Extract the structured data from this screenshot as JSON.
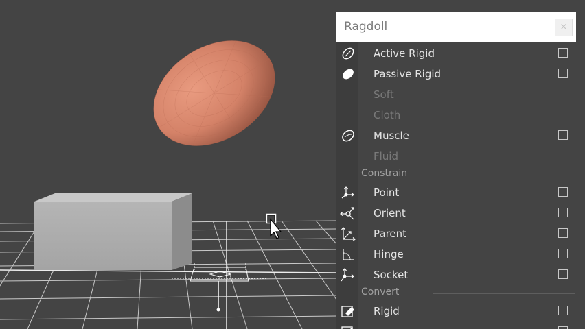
{
  "menu": {
    "title": "Ragdoll",
    "close_label": "×",
    "items": [
      {
        "label": "Active Rigid",
        "icon": "active-rigid-icon",
        "enabled": true,
        "has_option": true
      },
      {
        "label": "Passive Rigid",
        "icon": "passive-rigid-icon",
        "enabled": true,
        "has_option": true
      },
      {
        "label": "Soft",
        "icon": "",
        "enabled": false,
        "has_option": false
      },
      {
        "label": "Cloth",
        "icon": "",
        "enabled": false,
        "has_option": false
      },
      {
        "label": "Muscle",
        "icon": "muscle-icon",
        "enabled": true,
        "has_option": true
      },
      {
        "label": "Fluid",
        "icon": "",
        "enabled": false,
        "has_option": false
      }
    ],
    "constrain": {
      "label": "Constrain",
      "items": [
        {
          "label": "Point",
          "icon": "point-constraint-icon"
        },
        {
          "label": "Orient",
          "icon": "orient-constraint-icon"
        },
        {
          "label": "Parent",
          "icon": "parent-constraint-icon"
        },
        {
          "label": "Hinge",
          "icon": "hinge-constraint-icon"
        },
        {
          "label": "Socket",
          "icon": "socket-constraint-icon"
        }
      ]
    },
    "convert": {
      "label": "Convert",
      "items": [
        {
          "label": "Rigid",
          "icon": "convert-rigid-icon"
        }
      ]
    }
  }
}
